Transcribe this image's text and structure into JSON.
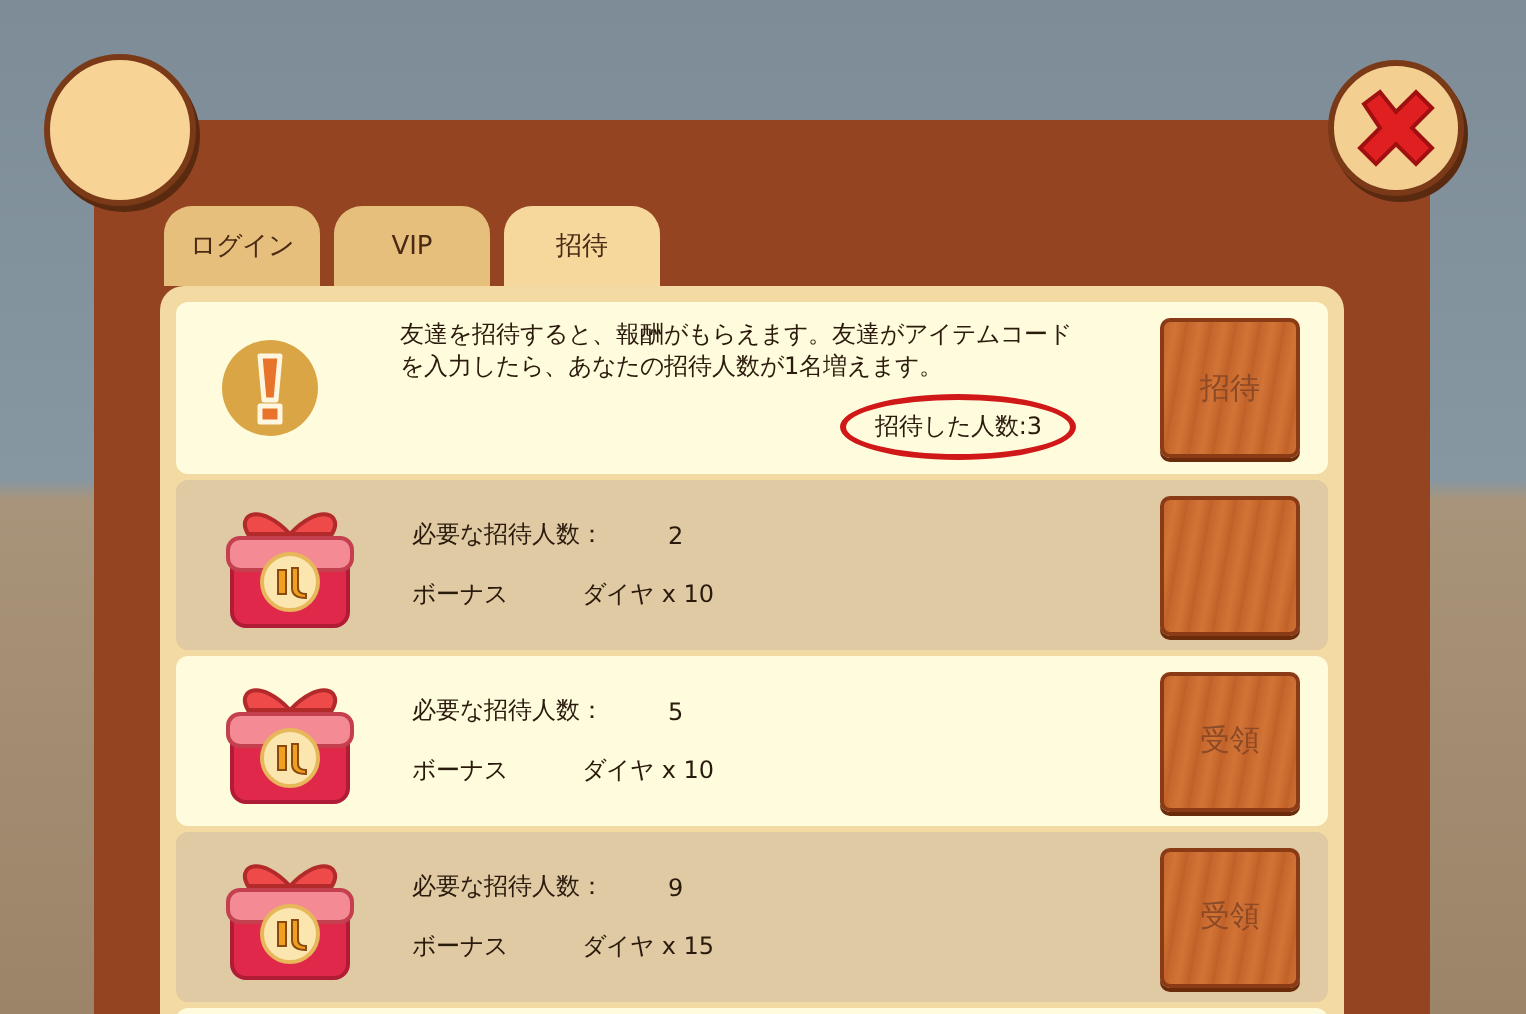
{
  "tabs": [
    {
      "label": "ログイン",
      "selected": false
    },
    {
      "label": "VIP",
      "selected": false
    },
    {
      "label": "招待",
      "selected": true
    }
  ],
  "invite_info": {
    "message": "友達を招待すると、報酬がもらえます。友達がアイテムコードを入力したら、あなたの招待人数が1名増えます。",
    "invited_count": "招待した人数:3",
    "button": "招待"
  },
  "rewards": [
    {
      "required_label": "必要な招待人数：",
      "required": "2",
      "bonus_label": "ボーナス",
      "bonus": "ダイヤ x 10"
    },
    {
      "required_label": "必要な招待人数：",
      "required": "5",
      "bonus_label": "ボーナス",
      "bonus": "ダイヤ x 10",
      "button": "受領"
    },
    {
      "required_label": "必要な招待人数：",
      "required": "9",
      "bonus_label": "ボーナス",
      "bonus": "ダイヤ x 15",
      "button": "受領"
    }
  ]
}
